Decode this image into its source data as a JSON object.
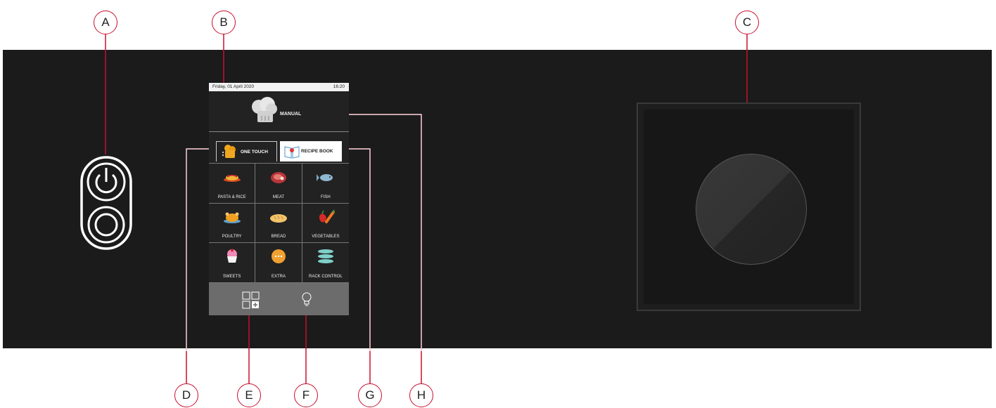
{
  "callouts": {
    "a": "A",
    "b": "B",
    "c": "C",
    "d": "D",
    "e": "E",
    "f": "F",
    "g": "G",
    "h": "H"
  },
  "screen": {
    "date": "Friday, 01 April 2020",
    "time": "16:20",
    "manual_label": "MANUAL",
    "tabs": {
      "one_touch": "ONE TOUCH",
      "recipe_book": "RECIPE BOOK"
    },
    "categories": [
      "PASTA & RICE",
      "MEAT",
      "FISH",
      "POULTRY",
      "BREAD",
      "VEGETABLES",
      "SWEETS",
      "EXTRA",
      "RACK CONTROL"
    ],
    "footer_icons": [
      "grid-add-icon",
      "lightbulb-icon"
    ]
  },
  "colors": {
    "callout_line": "#c8102e",
    "panel": "#1b1b1b",
    "screen": "#222222",
    "footer": "#6c6c6c"
  }
}
